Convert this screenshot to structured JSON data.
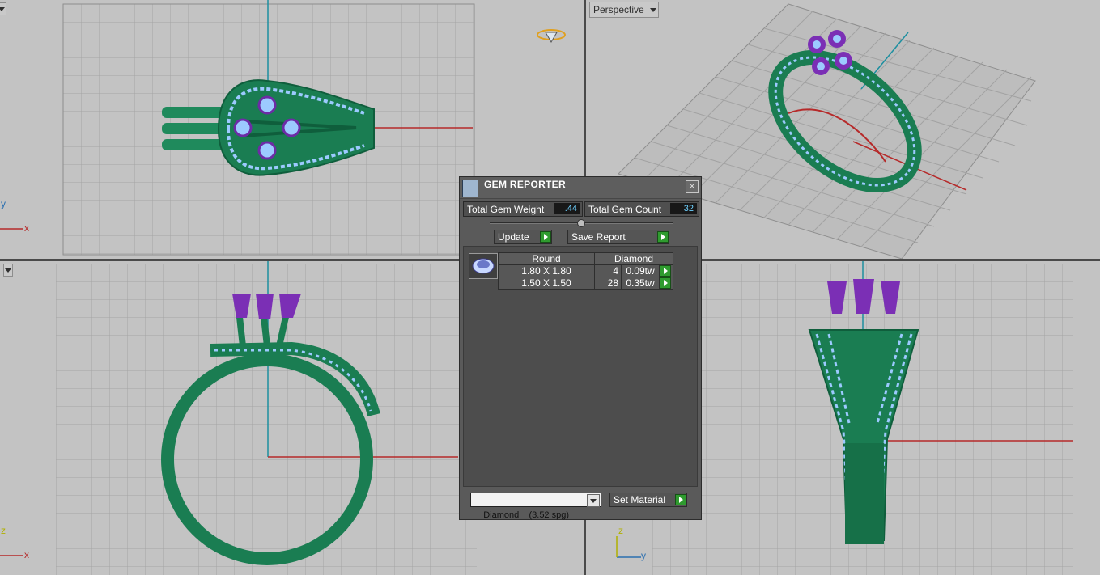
{
  "viewports": {
    "top": {
      "axis_x": "x",
      "axis_y": "y"
    },
    "perspective": {
      "label": "Perspective"
    },
    "front": {
      "axis_x": "x",
      "axis_y": "z"
    },
    "right": {
      "axis_x": "y",
      "axis_y": "z"
    }
  },
  "gem_reporter": {
    "title": "GEM REPORTER",
    "close_glyph": "×",
    "total_weight_label": "Total Gem Weight",
    "total_weight_value": ".44",
    "total_count_label": "Total Gem Count",
    "total_count_value": "32",
    "update_label": "Update",
    "save_report_label": "Save Report",
    "table": {
      "headers": [
        "Round",
        "Diamond"
      ],
      "rows": [
        {
          "size": "1.80 X 1.80",
          "count": "4",
          "weight": "0.09tw"
        },
        {
          "size": "1.50 X 1.50",
          "count": "28",
          "weight": "0.35tw"
        }
      ]
    },
    "material_select": "Diamond    (3.52 spg)",
    "set_material_label": "Set Material"
  },
  "colors": {
    "viewport_bg": "#c3c3c3",
    "grid": "#9e9e9e",
    "axis_red": "#b62a2a",
    "axis_cyan": "#1d8fa0",
    "ring_green": "#1f8a5c",
    "gem_blue": "#8fc2ff",
    "prong_purple": "#7b2fb5",
    "value_blue": "#6ed1ff"
  },
  "icons": [
    "gem-reporter-icon",
    "close-icon",
    "play-icon",
    "dropdown-arrow-icon",
    "diamond-thumbnail-icon",
    "gem-gizmo-icon"
  ]
}
